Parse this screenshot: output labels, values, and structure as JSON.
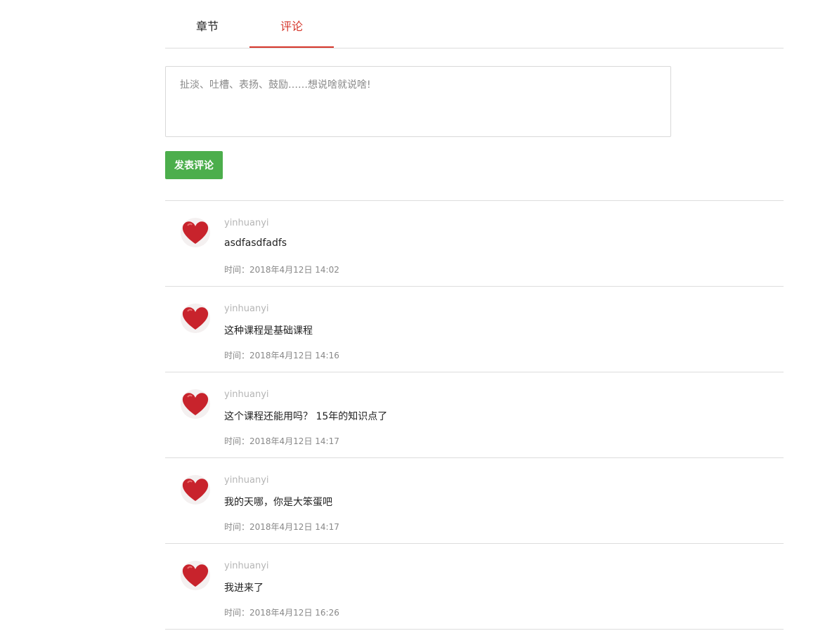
{
  "tabs": [
    {
      "label": "章节",
      "active": false
    },
    {
      "label": "评论",
      "active": true
    }
  ],
  "editor": {
    "placeholder": "扯淡、吐槽、表扬、鼓励……想说啥就说啥!",
    "value": ""
  },
  "submit_label": "发表评论",
  "colors": {
    "accent_red": "#d6362b",
    "submit_green": "#4cae4c",
    "avatar_heart": "#c8232c"
  },
  "comments": [
    {
      "avatar_icon": "heart-icon",
      "user": "yinhuanyi",
      "text": "asdfasdfadfs",
      "time": "时间：2018年4月12日 14:02"
    },
    {
      "avatar_icon": "heart-icon",
      "user": "yinhuanyi",
      "text": "这种课程是基础课程",
      "time": "时间：2018年4月12日 14:16"
    },
    {
      "avatar_icon": "heart-icon",
      "user": "yinhuanyi",
      "text": "这个课程还能用吗？ 15年的知识点了",
      "time": "时间：2018年4月12日 14:17"
    },
    {
      "avatar_icon": "heart-icon",
      "user": "yinhuanyi",
      "text": "我的天哪，你是大笨蛋吧",
      "time": "时间：2018年4月12日 14:17"
    },
    {
      "avatar_icon": "heart-icon",
      "user": "yinhuanyi",
      "text": "我进来了",
      "time": "时间：2018年4月12日 16:26"
    }
  ]
}
